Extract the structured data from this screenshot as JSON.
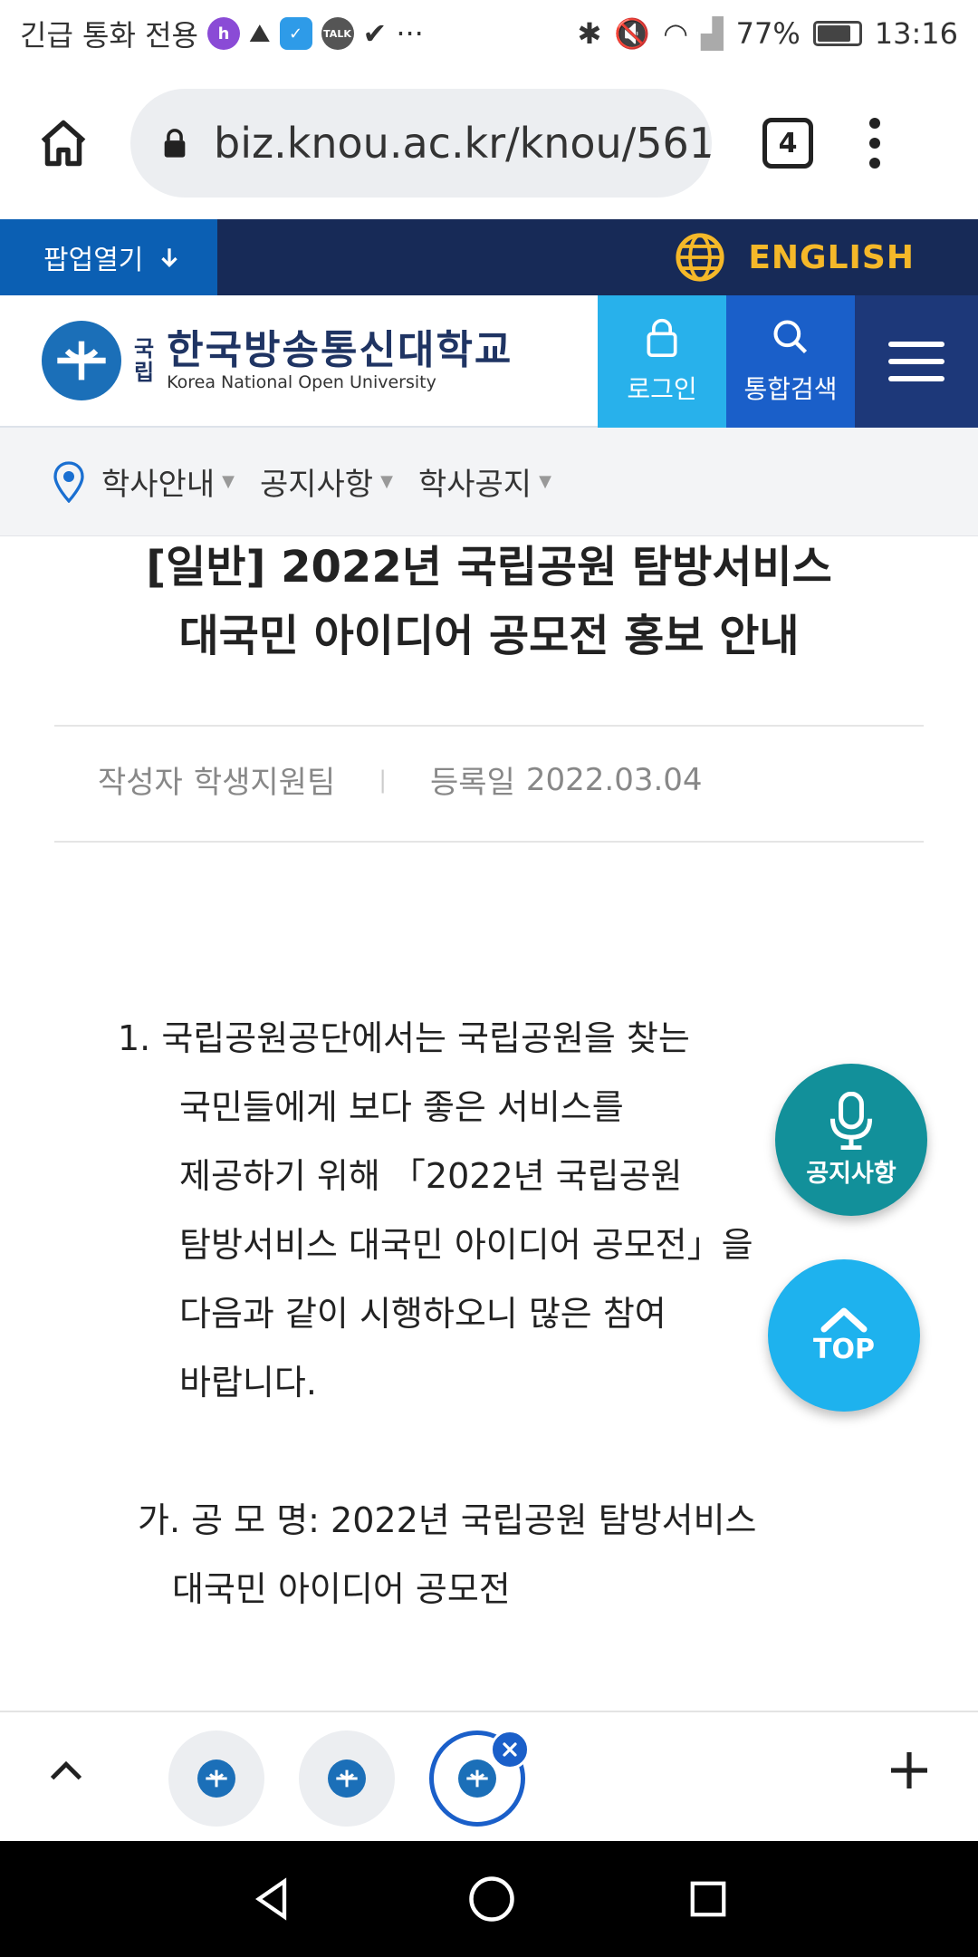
{
  "status_bar": {
    "carrier_text": "긴급 통화 전용",
    "battery": "77%",
    "time": "13:16",
    "more": "···"
  },
  "browser": {
    "url": "biz.knou.ac.kr/knou/561",
    "tab_count": "4"
  },
  "site": {
    "popup_label": "팝업열기",
    "english_label": "ENGLISH",
    "logo_guk": "국",
    "logo_rip": "립",
    "logo_name_ko": "한국방송통신대학교",
    "logo_name_en": "Korea National Open University",
    "login_label": "로그인",
    "search_label": "통합검색"
  },
  "breadcrumb": [
    "학사안내",
    "공지사항",
    "학사공지"
  ],
  "article": {
    "title_line1": "[일반] 2022년 국립공원 탐방서비스",
    "title_line2": "대국민 아이디어 공모전 홍보 안내",
    "author_label": "작성자",
    "author": "학생지원팀",
    "separator": "|",
    "date_label": "등록일",
    "date": "2022.03.04",
    "para1_lines": [
      "1. 국립공원공단에서는 국립공원을 찾는",
      "국민들에게 보다 좋은 서비스를",
      "제공하기 위해 「2022년 국립공원",
      "탐방서비스 대국민 아이디어 공모전」을",
      "다음과 같이 시행하오니 많은 참여",
      "바랍니다."
    ],
    "para2_lines": [
      "가. 공 모 명: 2022년 국립공원 탐방서비스",
      "대국민 아이디어 공모전"
    ]
  },
  "fab": {
    "notice_label": "공지사항",
    "top_label": "TOP"
  },
  "colors": {
    "top_strip": "#172a57",
    "popup_btn": "#0b5fb3",
    "english": "#f5b829",
    "login_btn": "#28b1eb",
    "search_btn": "#1a5fc9",
    "menu_btn": "#1d3879",
    "fab_notice": "#12909a",
    "fab_top": "#1eb2ee"
  }
}
